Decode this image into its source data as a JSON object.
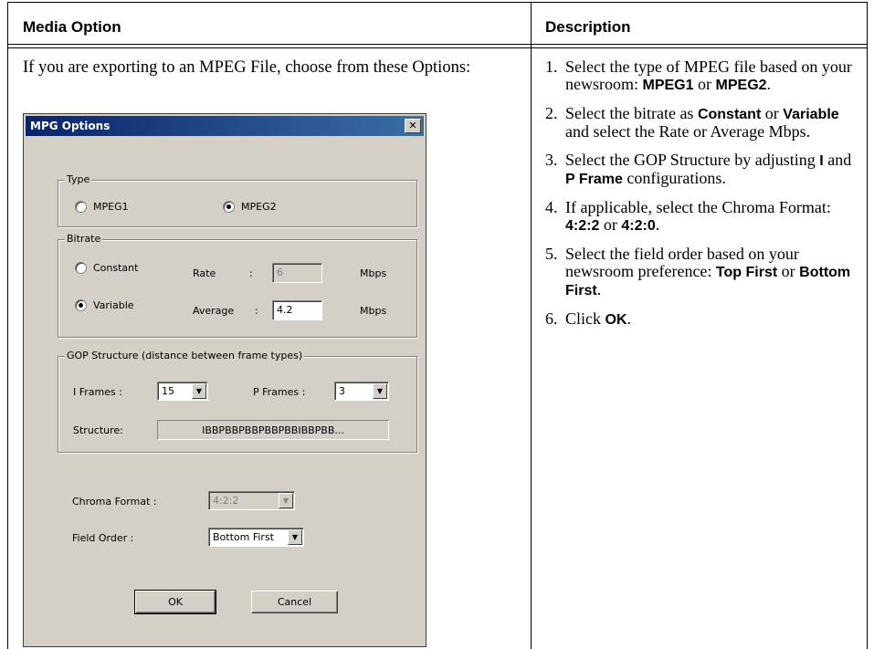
{
  "table": {
    "header_left": "Media Option",
    "header_right": "Description",
    "intro": "If you are exporting to an MPEG File, choose from these Options:"
  },
  "steps": [
    {
      "num": "1.",
      "parts": [
        [
          "t",
          "Select the type of MPEG file based on your newsroom: "
        ],
        [
          "b",
          "MPEG1"
        ],
        [
          "t",
          " or "
        ],
        [
          "b",
          "MPEG2"
        ],
        [
          "t",
          "."
        ]
      ]
    },
    {
      "num": "2.",
      "parts": [
        [
          "t",
          "Select the bitrate as "
        ],
        [
          "b",
          "Constant"
        ],
        [
          "t",
          " or "
        ],
        [
          "b",
          "Variable"
        ],
        [
          "t",
          " and select the Rate or Average Mbps."
        ]
      ]
    },
    {
      "num": "3.",
      "parts": [
        [
          "t",
          "Select the GOP Structure by adjusting "
        ],
        [
          "b",
          "I"
        ],
        [
          "t",
          " and "
        ],
        [
          "b",
          "P Frame"
        ],
        [
          "t",
          " configurations."
        ]
      ]
    },
    {
      "num": "4.",
      "parts": [
        [
          "t",
          "If applicable, select the Chroma Format: "
        ],
        [
          "b",
          "4:2:2"
        ],
        [
          "t",
          " or "
        ],
        [
          "b",
          "4:2:0"
        ],
        [
          "t",
          "."
        ]
      ]
    },
    {
      "num": "5.",
      "parts": [
        [
          "t",
          "Select the field order based on your newsroom preference: "
        ],
        [
          "b",
          "Top First"
        ],
        [
          "t",
          " or "
        ],
        [
          "b",
          "Bottom First"
        ],
        [
          "t",
          "."
        ]
      ]
    },
    {
      "num": "6.",
      "parts": [
        [
          "t",
          "Click "
        ],
        [
          "b",
          "OK"
        ],
        [
          "t",
          "."
        ]
      ]
    }
  ],
  "dialog": {
    "title": "MPG Options",
    "close_glyph": "✕",
    "type_group": {
      "label": "Type",
      "mpeg1": "MPEG1",
      "mpeg2": "MPEG2",
      "selected": "MPEG2"
    },
    "bitrate_group": {
      "label": "Bitrate",
      "constant": "Constant",
      "variable": "Variable",
      "selected": "Variable",
      "rate_label": "Rate",
      "rate_colon": ":",
      "rate_value": "6",
      "rate_unit": "Mbps",
      "average_label": "Average",
      "average_colon": ":",
      "average_value": "4.2",
      "average_unit": "Mbps"
    },
    "gop_group": {
      "label": "GOP Structure (distance between frame types)",
      "i_frames_label": "I Frames :",
      "i_frames_value": "15",
      "p_frames_label": "P Frames :",
      "p_frames_value": "3",
      "structure_label": "Structure:",
      "structure_value": "IBBPBBPBBPBBPBBIBBPBB..."
    },
    "chroma_label": "Chroma Format :",
    "chroma_value": "4:2:2",
    "field_order_label": "Field Order :",
    "field_order_value": "Bottom First",
    "ok_label": "OK",
    "cancel_label": "Cancel",
    "arrow_glyph": "▼"
  }
}
